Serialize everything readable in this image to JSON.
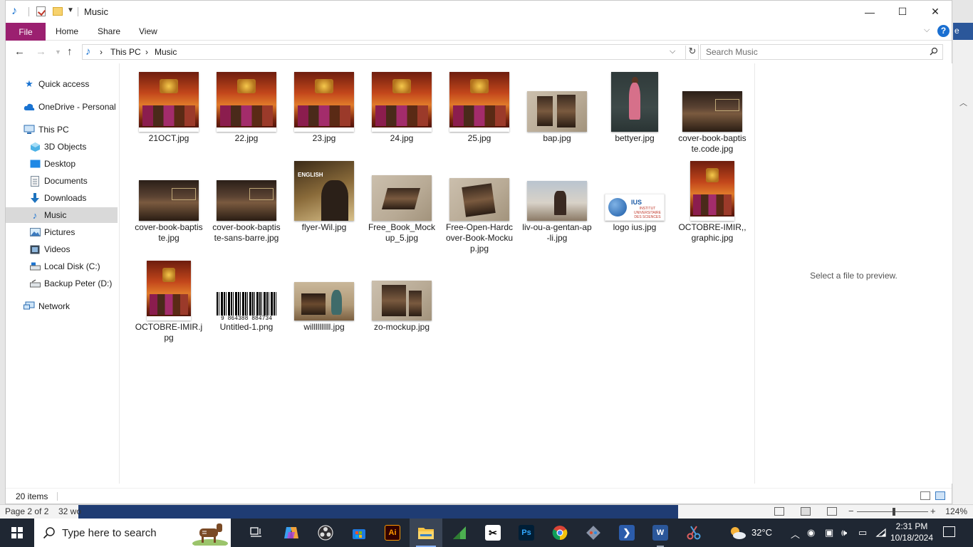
{
  "window": {
    "title": "Music",
    "controls": {
      "minimize": "—",
      "maximize": "☐",
      "close": "✕"
    }
  },
  "ribbon": {
    "tabs": [
      "File",
      "Home",
      "Share",
      "View"
    ],
    "help": "?"
  },
  "word_background": {
    "ribbon_letter": "e",
    "page_status": "Page 2 of 2",
    "word_status": "32 wo",
    "zoom": "124%"
  },
  "address": {
    "crumbs": [
      "This PC",
      "Music"
    ],
    "separator": "›"
  },
  "search": {
    "placeholder": "Search Music"
  },
  "nav_pane": {
    "items": [
      {
        "label": "Quick access",
        "icon": "star-icon"
      },
      {
        "label": "OneDrive - Personal",
        "icon": "cloud-icon"
      },
      {
        "label": "This PC",
        "icon": "computer-icon"
      },
      {
        "label": "3D Objects",
        "icon": "cube-icon"
      },
      {
        "label": "Desktop",
        "icon": "desktop-icon"
      },
      {
        "label": "Documents",
        "icon": "document-icon"
      },
      {
        "label": "Downloads",
        "icon": "download-icon"
      },
      {
        "label": "Music",
        "icon": "music-icon",
        "selected": true
      },
      {
        "label": "Pictures",
        "icon": "pictures-icon"
      },
      {
        "label": "Videos",
        "icon": "videos-icon"
      },
      {
        "label": "Local Disk (C:)",
        "icon": "drive-icon"
      },
      {
        "label": "Backup Peter (D:)",
        "icon": "drive-icon"
      },
      {
        "label": "Network",
        "icon": "network-icon"
      }
    ]
  },
  "files": [
    {
      "name": "21OCT.jpg",
      "kind": "poster"
    },
    {
      "name": "22.jpg",
      "kind": "poster"
    },
    {
      "name": "23.jpg",
      "kind": "poster"
    },
    {
      "name": "24.jpg",
      "kind": "poster"
    },
    {
      "name": "25.jpg",
      "kind": "poster"
    },
    {
      "name": "bap.jpg",
      "kind": "mock"
    },
    {
      "name": "bettyer.jpg",
      "kind": "portrait"
    },
    {
      "name": "cover-book-baptiste.code.jpg",
      "kind": "bookcover"
    },
    {
      "name": "cover-book-baptiste.jpg",
      "kind": "bookcover"
    },
    {
      "name": "cover-book-baptiste-sans-barre.jpg",
      "kind": "bookcover"
    },
    {
      "name": "flyer-Wil.jpg",
      "kind": "flyer"
    },
    {
      "name": "Free_Book_Mockup_5.jpg",
      "kind": "mock"
    },
    {
      "name": "Free-Open-Hardcover-Book-Mockup.jpg",
      "kind": "mock"
    },
    {
      "name": "liv-ou-a-gentan-ap-li.jpg",
      "kind": "livphoto"
    },
    {
      "name": "logo ius.jpg",
      "kind": "logo"
    },
    {
      "name": "OCTOBRE-IMIR,,graphic.jpg",
      "kind": "poster"
    },
    {
      "name": "OCTOBRE-IMIR.jpg",
      "kind": "poster"
    },
    {
      "name": "Untitled-1.png",
      "kind": "barcode"
    },
    {
      "name": "willllllllll.jpg",
      "kind": "wilphoto"
    },
    {
      "name": "zo-mockup.jpg",
      "kind": "mock"
    }
  ],
  "thumb_text": {
    "flyer": "ENGLISH",
    "logo_abbr": "IUS",
    "logo_sub": "INSTITUT UNIVERSITAIRE DES SCIENCES",
    "barcode": "9  864388  884734"
  },
  "preview": {
    "text": "Select a file to preview."
  },
  "status": {
    "items": "20 items"
  },
  "taskbar": {
    "search_placeholder": "Type here to search",
    "weather": "32°C",
    "time": "2:31 PM",
    "date": "10/18/2024",
    "apps": [
      {
        "name": "task-view",
        "icon": "task-view-icon"
      },
      {
        "name": "copilot",
        "icon": "copilot-icon"
      },
      {
        "name": "obs",
        "icon": "obs-icon"
      },
      {
        "name": "store",
        "icon": "store-icon"
      },
      {
        "name": "illustrator",
        "icon": "illustrator-icon",
        "label": "Ai"
      },
      {
        "name": "file-explorer",
        "icon": "folder-icon",
        "active": true
      },
      {
        "name": "camtasia",
        "icon": "camtasia-icon"
      },
      {
        "name": "capcut",
        "icon": "capcut-icon"
      },
      {
        "name": "photoshop",
        "icon": "photoshop-icon",
        "label": "Ps"
      },
      {
        "name": "chrome",
        "icon": "chrome-icon"
      },
      {
        "name": "git",
        "icon": "git-icon"
      },
      {
        "name": "powershell",
        "icon": "powershell-icon"
      },
      {
        "name": "word",
        "icon": "word-icon",
        "label": "W",
        "running": true
      },
      {
        "name": "snipping",
        "icon": "snipping-icon"
      }
    ]
  },
  "colors": {
    "file_tab": "#9b2070",
    "selection": "#d9d9d9",
    "taskbar": "#1f2733",
    "accent": "#1a6fd1"
  }
}
